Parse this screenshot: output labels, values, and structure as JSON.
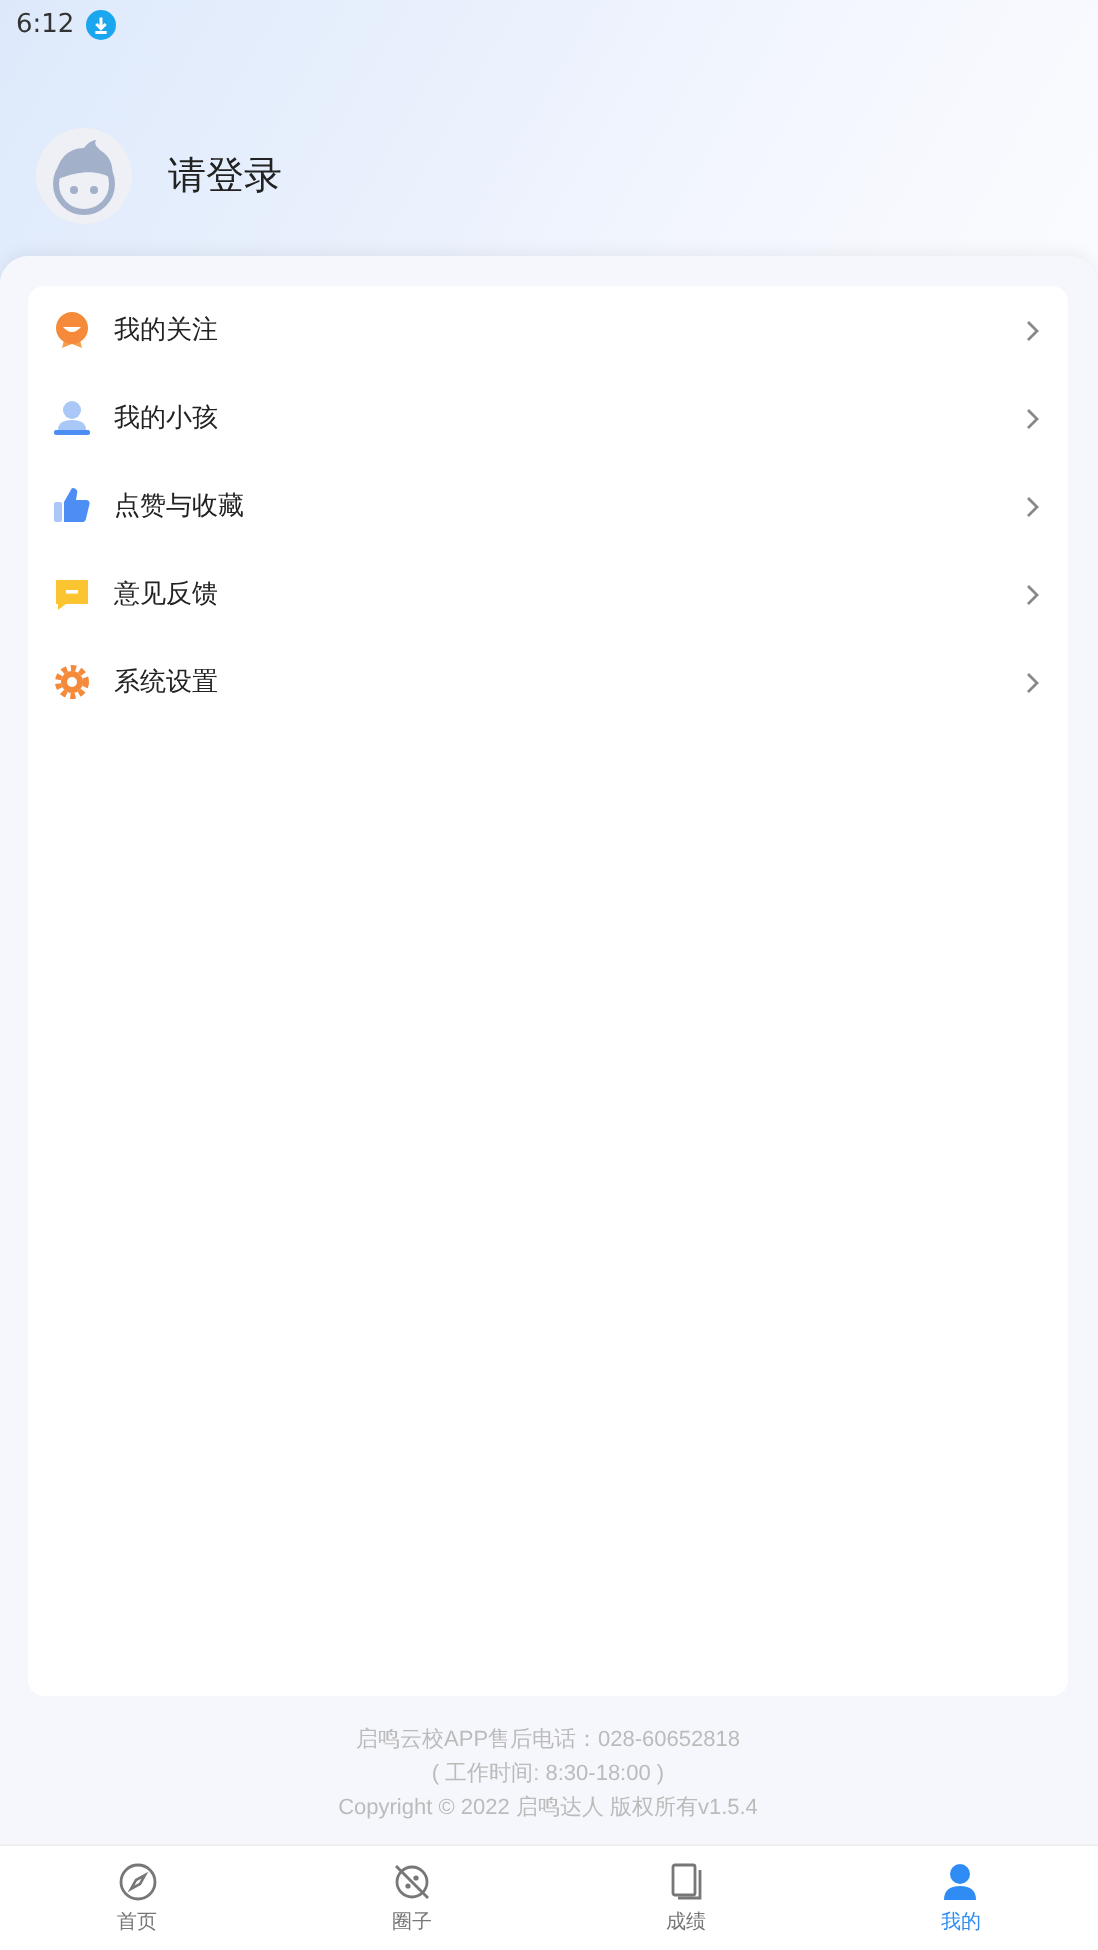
{
  "status_bar": {
    "time": "6:12"
  },
  "profile": {
    "name": "请登录"
  },
  "menu": [
    {
      "kind": "follow",
      "label": "我的关注"
    },
    {
      "kind": "child",
      "label": "我的小孩"
    },
    {
      "kind": "like",
      "label": "点赞与收藏"
    },
    {
      "kind": "feedback",
      "label": "意见反馈"
    },
    {
      "kind": "settings",
      "label": "系统设置"
    }
  ],
  "footer": [
    "启鸣云校APP售后电话：028-60652818",
    "( 工作时间: 8:30-18:00 )",
    "Copyright © 2022 启鸣达人 版权所有v1.5.4"
  ],
  "tabs": [
    {
      "kind": "home",
      "label": "首页",
      "selected": false
    },
    {
      "kind": "circle",
      "label": "圈子",
      "selected": false
    },
    {
      "kind": "grades",
      "label": "成绩",
      "selected": false
    },
    {
      "kind": "me",
      "label": "我的",
      "selected": true
    }
  ]
}
